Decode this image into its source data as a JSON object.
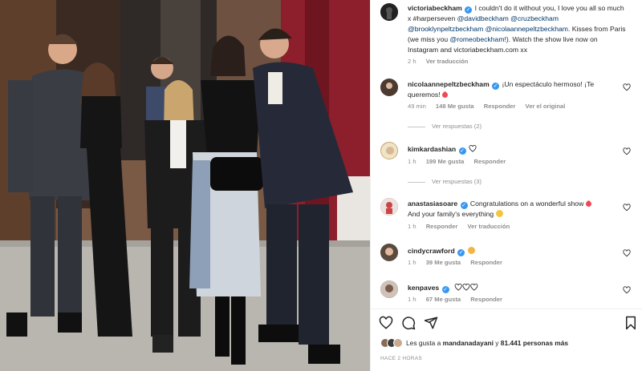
{
  "caption": {
    "username": "victoriabeckham",
    "text_parts": [
      "I couldn't do it without you, I love you all so much x #harperseven ",
      "@davidbeckham",
      " ",
      "@cruzbeckham",
      " ",
      "@brooklynpeltzbeckham",
      " ",
      "@nicolaannepeltzbeckham",
      ". Kisses from Paris (we miss you ",
      "@romeobeckham",
      "!). Watch the show live now on Instagram and victoriabeckham.com xx"
    ],
    "time": "2 h",
    "translate": "Ver traducción"
  },
  "comments": [
    {
      "username": "nicolaannepeltzbeckham",
      "text": "¡Un espectáculo hermoso! ¡Te queremos!",
      "time": "49 min",
      "likes": "148 Me gusta",
      "reply": "Responder",
      "extra": "Ver el original",
      "replies": "Ver respuestas (2)"
    },
    {
      "username": "kimkardashian",
      "text": "",
      "time": "1 h",
      "likes": "199 Me gusta",
      "reply": "Responder",
      "replies": "Ver respuestas (3)"
    },
    {
      "username": "anastasiasoare",
      "text": "Congratulations on a wonderful show",
      "text2": "And your family's everything",
      "time": "1 h",
      "likes": "",
      "reply": "Responder",
      "extra": "Ver traducción"
    },
    {
      "username": "cindycrawford",
      "text": "",
      "time": "1 h",
      "likes": "39 Me gusta",
      "reply": "Responder"
    },
    {
      "username": "kenpaves",
      "text": "",
      "time": "1 h",
      "likes": "67 Me gusta",
      "reply": "Responder"
    }
  ],
  "likes_line": {
    "prefix": "Les gusta a ",
    "user": "mandanadayani",
    "middle": " y ",
    "count": "81.441 personas más"
  },
  "posted": "HACE 2 HORAS",
  "icons": [
    "heart-icon",
    "comment-icon",
    "share-icon",
    "bookmark-icon",
    "verified-icon"
  ],
  "colors": {
    "verified": "#3897f0",
    "mention": "#00376b",
    "muted": "#8e8e8e",
    "heart_red": "#ed4956"
  }
}
